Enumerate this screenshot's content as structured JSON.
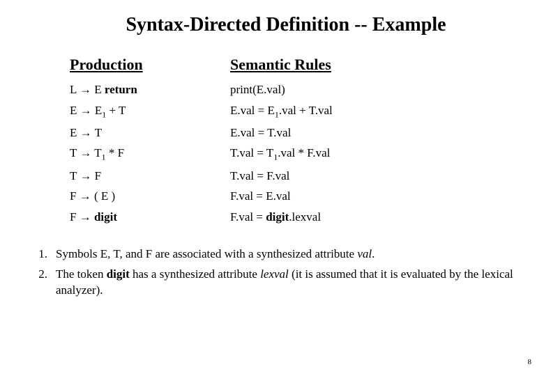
{
  "title": "Syntax-Directed Definition -- Example",
  "headers": {
    "production": "Production",
    "semantic": "Semantic Rules"
  },
  "rules": [
    {
      "prod_html": "L → E <b>return</b>",
      "sem_html": "print(E.val)"
    },
    {
      "prod_html": "E → E<sub>1</sub> + T",
      "sem_html": "E.val = E<sub>1</sub>.val + T.val"
    },
    {
      "prod_html": "E → T",
      "sem_html": "E.val = T.val"
    },
    {
      "prod_html": "T → T<sub>1</sub> * F",
      "sem_html": "T.val = T<sub>1</sub>.val * F.val"
    },
    {
      "prod_html": "T → F",
      "sem_html": "T.val = F.val"
    },
    {
      "prod_html": "F → ( E )",
      "sem_html": "F.val = E.val"
    },
    {
      "prod_html": "F → <b>digit</b>",
      "sem_html": "F.val = <b>digit</b>.lexval"
    }
  ],
  "notes": [
    {
      "num": "1.",
      "html": "Symbols E, T, and F are associated with a synthesized attribute <span class=\"italic\">val</span>."
    },
    {
      "num": "2.",
      "html": "The token <span class=\"bold\">digit</span> has a synthesized attribute <span class=\"italic\">lexval</span> (it is assumed that it is evaluated by the lexical analyzer)."
    }
  ],
  "page_number": "8"
}
